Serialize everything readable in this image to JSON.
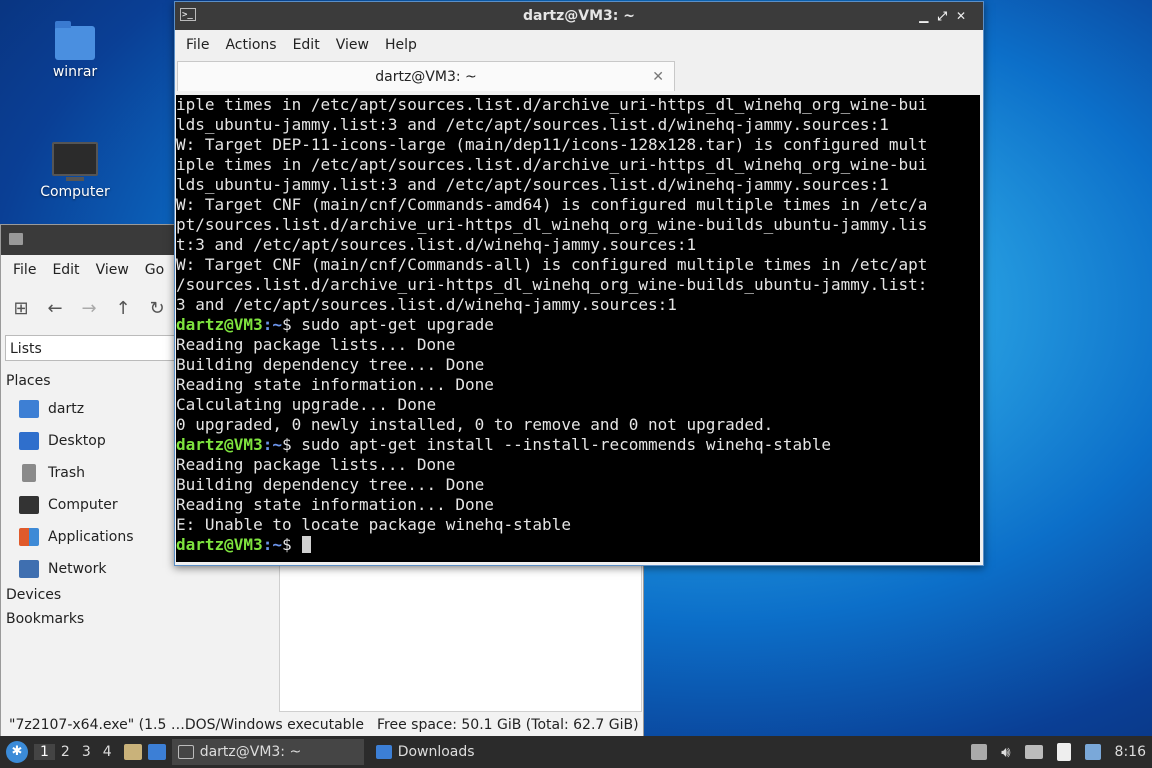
{
  "desktop": {
    "icons": [
      {
        "label": "winrar"
      },
      {
        "label": "Computer"
      }
    ]
  },
  "file_manager": {
    "menu": [
      "File",
      "Edit",
      "View",
      "Go"
    ],
    "location_mode": "Lists",
    "sidebar": {
      "places_heading": "Places",
      "places": [
        {
          "label": "dartz",
          "icon": "home-folder-icon",
          "color": "#3d7fd4"
        },
        {
          "label": "Desktop",
          "icon": "desktop-icon",
          "color": "#2f6fcc"
        },
        {
          "label": "Trash",
          "icon": "trash-icon",
          "color": "#8a8a8a"
        },
        {
          "label": "Computer",
          "icon": "computer-icon",
          "color": "#333333"
        },
        {
          "label": "Applications",
          "icon": "applications-icon",
          "color": "#e05a2b"
        },
        {
          "label": "Network",
          "icon": "network-icon",
          "color": "#3f6fb0"
        }
      ],
      "devices_heading": "Devices",
      "bookmarks_heading": "Bookmarks"
    },
    "status_left": "\"7z2107-x64.exe\" (1.5 …DOS/Windows executable",
    "status_right": "Free space: 50.1 GiB (Total: 62.7 GiB)"
  },
  "terminal": {
    "title": "dartz@VM3: ~",
    "menu": [
      "File",
      "Actions",
      "Edit",
      "View",
      "Help"
    ],
    "tab_label": "dartz@VM3: ~",
    "prompt_user": "dartz@VM3",
    "prompt_path": ":~",
    "lines": [
      {
        "type": "out",
        "text": "iple times in /etc/apt/sources.list.d/archive_uri-https_dl_winehq_org_wine-bui"
      },
      {
        "type": "out",
        "text": "lds_ubuntu-jammy.list:3 and /etc/apt/sources.list.d/winehq-jammy.sources:1"
      },
      {
        "type": "out",
        "text": "W: Target DEP-11-icons-large (main/dep11/icons-128x128.tar) is configured mult"
      },
      {
        "type": "out",
        "text": "iple times in /etc/apt/sources.list.d/archive_uri-https_dl_winehq_org_wine-bui"
      },
      {
        "type": "out",
        "text": "lds_ubuntu-jammy.list:3 and /etc/apt/sources.list.d/winehq-jammy.sources:1"
      },
      {
        "type": "out",
        "text": "W: Target CNF (main/cnf/Commands-amd64) is configured multiple times in /etc/a"
      },
      {
        "type": "out",
        "text": "pt/sources.list.d/archive_uri-https_dl_winehq_org_wine-builds_ubuntu-jammy.lis"
      },
      {
        "type": "out",
        "text": "t:3 and /etc/apt/sources.list.d/winehq-jammy.sources:1"
      },
      {
        "type": "out",
        "text": "W: Target CNF (main/cnf/Commands-all) is configured multiple times in /etc/apt"
      },
      {
        "type": "out",
        "text": "/sources.list.d/archive_uri-https_dl_winehq_org_wine-builds_ubuntu-jammy.list:"
      },
      {
        "type": "out",
        "text": "3 and /etc/apt/sources.list.d/winehq-jammy.sources:1"
      },
      {
        "type": "cmd",
        "text": "$ sudo apt-get upgrade"
      },
      {
        "type": "out",
        "text": "Reading package lists... Done"
      },
      {
        "type": "out",
        "text": "Building dependency tree... Done"
      },
      {
        "type": "out",
        "text": "Reading state information... Done"
      },
      {
        "type": "out",
        "text": "Calculating upgrade... Done"
      },
      {
        "type": "out",
        "text": "0 upgraded, 0 newly installed, 0 to remove and 0 not upgraded."
      },
      {
        "type": "cmd",
        "text": "$ sudo apt-get install --install-recommends winehq-stable"
      },
      {
        "type": "out",
        "text": "Reading package lists... Done"
      },
      {
        "type": "out",
        "text": "Building dependency tree... Done"
      },
      {
        "type": "out",
        "text": "Reading state information... Done"
      },
      {
        "type": "out",
        "text": "E: Unable to locate package winehq-stable"
      },
      {
        "type": "cmd",
        "text": "$ ",
        "cursor": true
      }
    ]
  },
  "taskbar": {
    "workspaces": [
      "1",
      "2",
      "3",
      "4"
    ],
    "active_workspace": "1",
    "tasks": [
      {
        "label": "dartz@VM3: ~",
        "icon": "terminal-icon",
        "active": true
      },
      {
        "label": "Downloads",
        "icon": "folder-icon",
        "active": false
      }
    ],
    "clock": "8:16"
  }
}
